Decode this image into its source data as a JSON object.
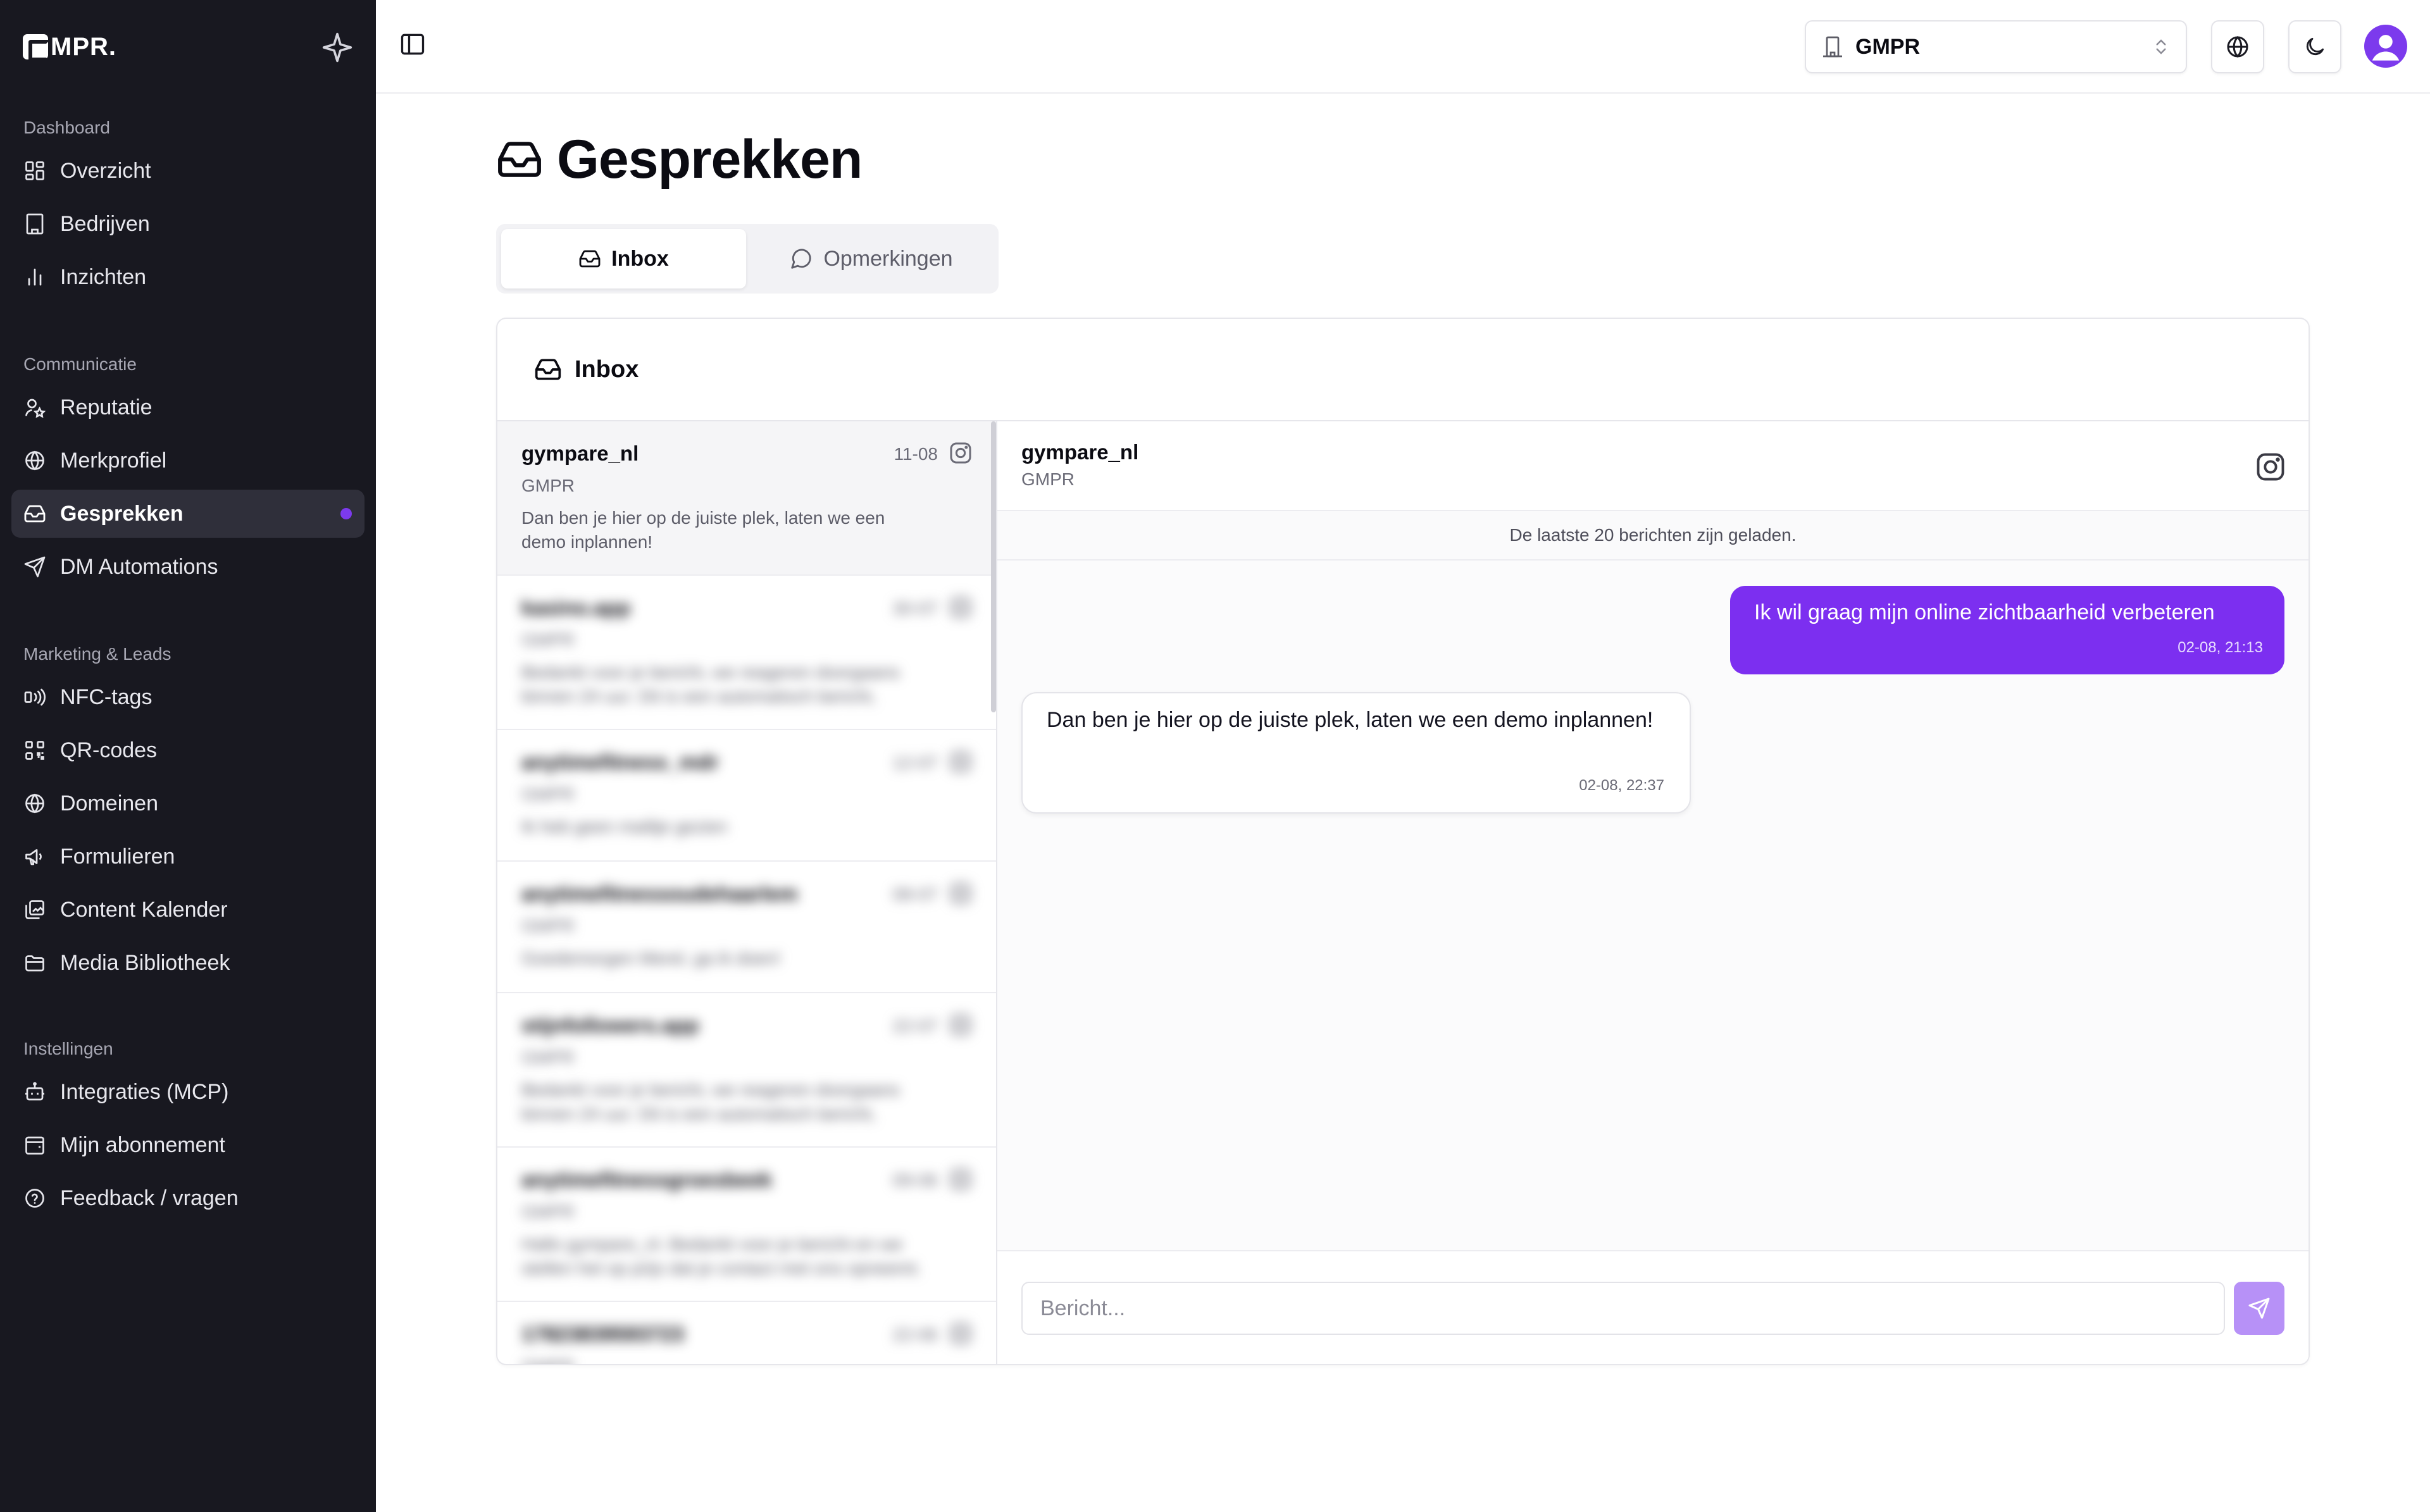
{
  "brand": {
    "name": "MPR."
  },
  "sidebar": {
    "groups": [
      {
        "title": "Dashboard",
        "items": [
          {
            "label": "Overzicht",
            "icon": "grid-icon"
          },
          {
            "label": "Bedrijven",
            "icon": "building-icon"
          },
          {
            "label": "Inzichten",
            "icon": "bar-chart-icon"
          }
        ]
      },
      {
        "title": "Communicatie",
        "items": [
          {
            "label": "Reputatie",
            "icon": "user-star-icon"
          },
          {
            "label": "Merkprofiel",
            "icon": "globe-icon"
          },
          {
            "label": "Gesprekken",
            "icon": "inbox-icon",
            "active": true,
            "badge": "dot"
          },
          {
            "label": "DM Automations",
            "icon": "send-icon"
          }
        ]
      },
      {
        "title": "Marketing & Leads",
        "items": [
          {
            "label": "NFC-tags",
            "icon": "nfc-icon"
          },
          {
            "label": "QR-codes",
            "icon": "qr-code-icon"
          },
          {
            "label": "Domeinen",
            "icon": "globe-icon"
          },
          {
            "label": "Formulieren",
            "icon": "megaphone-icon"
          },
          {
            "label": "Content Kalender",
            "icon": "image-stack-icon"
          },
          {
            "label": "Media Bibliotheek",
            "icon": "folder-icon"
          }
        ]
      },
      {
        "title": "Instellingen",
        "items": [
          {
            "label": "Integraties (MCP)",
            "icon": "robot-icon"
          },
          {
            "label": "Mijn abonnement",
            "icon": "wallet-icon"
          },
          {
            "label": "Feedback / vragen",
            "icon": "help-circle-icon"
          }
        ]
      }
    ]
  },
  "topbar": {
    "org_select": "GMPR"
  },
  "page": {
    "title": "Gesprekken"
  },
  "tabs": [
    {
      "label": "Inbox",
      "active": true
    },
    {
      "label": "Opmerkingen",
      "active": false
    }
  ],
  "card": {
    "title": "Inbox"
  },
  "conversations": [
    {
      "name": "gympare_nl",
      "date": "11-08",
      "org": "GMPR",
      "preview": "Dan ben je hier op de juiste plek, laten we een demo inplannen!",
      "selected": true
    },
    {
      "name": "kasino.app",
      "date": "30-07",
      "org": "GMPR",
      "preview": "Bedankt voor je bericht, we reageren doorgaans binnen 24 uur. Dit is een automatisch bericht, bedankt.",
      "blurred": true
    },
    {
      "name": "anytimefitness_mdr",
      "date": "12-07",
      "org": "GMPR",
      "preview": "Ik heb geen mailtje gezien",
      "blurred": true
    },
    {
      "name": "anytimefitnessoudehaarlem",
      "date": "08-07",
      "org": "GMPR",
      "preview": "Goedemorgen Merel, ga ik doen!",
      "blurred": true
    },
    {
      "name": "stijnfollowers.app",
      "date": "22-07",
      "org": "GMPR",
      "preview": "Bedankt voor je bericht, we reageren doorgaans binnen 24 uur. Dit is een automatisch bericht, bedankt.",
      "blurred": true
    },
    {
      "name": "anytimefitnessgroesbeek",
      "date": "09-06",
      "org": "GMPR",
      "preview": "Hallo gympare_nl. Bedankt voor je bericht en we stellen het op prijs dat je contact met ons opneemt.",
      "blurred": true
    },
    {
      "name": "17823839593723",
      "date": "22-06",
      "org": "GMPR",
      "preview": "",
      "blurred": true
    }
  ],
  "chat": {
    "name": "gympare_nl",
    "org": "GMPR",
    "notice": "De laatste 20 berichten zijn geladen.",
    "messages": [
      {
        "direction": "out",
        "text": "Ik wil graag mijn online zichtbaarheid verbeteren",
        "time": "02-08, 21:13"
      },
      {
        "direction": "in",
        "text": "Dan ben je hier op de juiste plek, laten we een demo inplannen!",
        "time": "02-08, 22:37"
      }
    ],
    "composer_placeholder": "Bericht..."
  },
  "colors": {
    "sidebar_bg": "#181820",
    "accent": "#7c3aed",
    "outgoing_bubble": "#7c2ff0",
    "send_button": "#b791f7"
  }
}
